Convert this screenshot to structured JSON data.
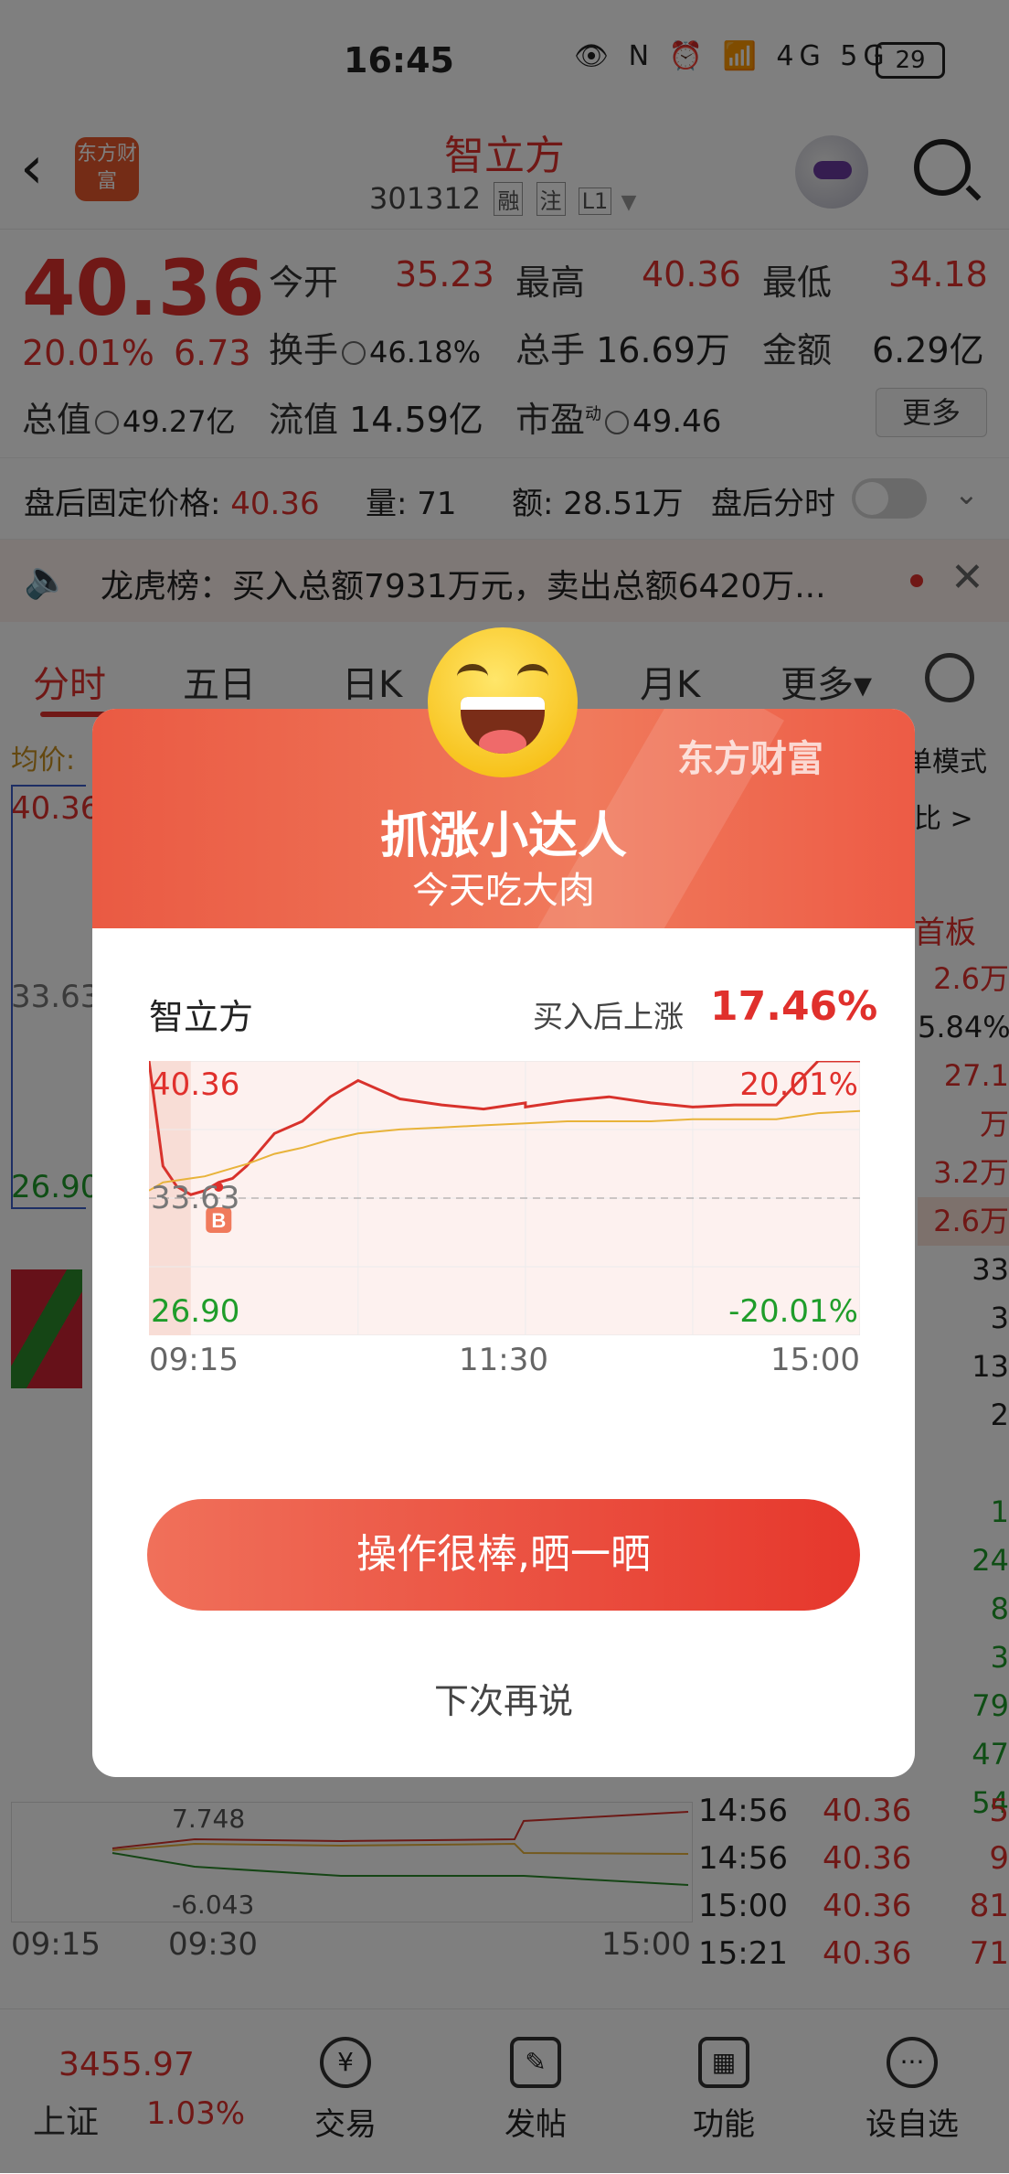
{
  "status_bar": {
    "time": "16:45",
    "icons_text": "👁 N ⏰ 📶 4G 5G",
    "battery": "29"
  },
  "header": {
    "logo": "东方财富",
    "title": "智立方",
    "code": "301312",
    "tags": [
      "融",
      "注",
      "L1"
    ]
  },
  "quote": {
    "price": "40.36",
    "pct": "20.01%",
    "change": "6.73",
    "open_label": "今开",
    "open": "35.23",
    "high_label": "最高",
    "high": "40.36",
    "low_label": "最低",
    "low": "34.18",
    "turnover_label": "换手",
    "turnover": "46.18%",
    "vol_label": "总手",
    "vol": "16.69万",
    "amount_label": "金额",
    "amount": "6.29亿",
    "mcap_label": "总值",
    "mcap": "49.27亿",
    "float_label": "流值",
    "float": "14.59亿",
    "pe_label": "市盈",
    "pe_sup": "动",
    "pe": "49.46",
    "more": "更多"
  },
  "after_hours": {
    "price_label": "盘后固定价格:",
    "price": "40.36",
    "qty_label": "量:",
    "qty": "71",
    "amt_label": "额:",
    "amt": "28.51万",
    "toggle_label": "盘后分时"
  },
  "banner": {
    "text": "龙虎榜：买入总额7931万元，卖出总额6420万..."
  },
  "tabs": [
    "分时",
    "五日",
    "日K",
    "月K",
    "更多▾"
  ],
  "background": {
    "avg_label": "均价:",
    "hi": "40.36",
    "mid": "33.63",
    "lo": "26.90",
    "mode": "单模式",
    "ratio": "比 >",
    "board": "首板",
    "right_col": [
      "2.6万",
      "5.84%",
      "27.1万",
      "3.2万",
      "2.6万",
      "33",
      "3",
      "13",
      "2",
      "1",
      "24",
      "8",
      "3",
      "79",
      "47",
      "54"
    ],
    "sub_hi": "7.748",
    "sub_lo": "-6.043",
    "sub_time_start": "09:15",
    "sub_time_mid": "09:30",
    "sub_time_end": "15:00",
    "ticks": [
      {
        "t": "14:56",
        "p": "40.36",
        "v": "5"
      },
      {
        "t": "14:56",
        "p": "40.36",
        "v": "9"
      },
      {
        "t": "15:00",
        "p": "40.36",
        "v": "81"
      },
      {
        "t": "15:21",
        "p": "40.36",
        "v": "71"
      }
    ]
  },
  "bottom_nav": {
    "index_value": "3455.97",
    "index_name": "上证",
    "index_pct": "1.03%",
    "items": [
      "交易",
      "发帖",
      "功能",
      "设自选"
    ]
  },
  "modal": {
    "brand": "东方财富",
    "title": "抓涨小达人",
    "subtitle": "今天吃大肉",
    "stock": "智立方",
    "gain_label": "买入后上涨",
    "gain": "17.46%",
    "y_high": "40.36",
    "y_mid": "33.63",
    "y_low": "26.90",
    "pct_high": "20.01%",
    "pct_low": "-20.01%",
    "times": [
      "09:15",
      "11:30",
      "15:00"
    ],
    "buy_marker": "B",
    "cta": "操作很棒,晒一晒",
    "later": "下次再说",
    "colors": {
      "price_line": "#d8322c",
      "avg_line": "#e8b33a",
      "accent": "#e0302c"
    }
  },
  "chart_data": {
    "type": "line",
    "x": [
      "09:15",
      "09:20",
      "09:25",
      "09:30",
      "09:35",
      "09:40",
      "09:45",
      "09:50",
      "10:00",
      "10:10",
      "10:20",
      "10:30",
      "10:45",
      "11:00",
      "11:15",
      "11:30",
      "13:00",
      "13:15",
      "13:30",
      "13:45",
      "14:00",
      "14:15",
      "14:30",
      "14:45",
      "15:00"
    ],
    "series": [
      {
        "values": [
          40.36,
          35.2,
          34.2,
          33.8,
          34.0,
          34.4,
          34.6,
          35.2,
          36.8,
          37.4,
          38.6,
          39.4,
          38.5,
          38.2,
          38.0,
          38.3,
          38.1,
          38.4,
          38.6,
          38.3,
          38.1,
          38.2,
          38.2,
          40.36,
          40.36
        ]
      },
      {
        "values": [
          34.0,
          34.4,
          34.5,
          34.6,
          34.7,
          34.9,
          35.1,
          35.3,
          35.8,
          36.1,
          36.5,
          36.8,
          37.0,
          37.1,
          37.2,
          37.3,
          37.3,
          37.4,
          37.4,
          37.4,
          37.5,
          37.5,
          37.5,
          37.8,
          37.9
        ]
      }
    ],
    "ylim": [
      26.9,
      40.36
    ],
    "buy_point": {
      "x": "09:40",
      "y": 33.63
    }
  }
}
